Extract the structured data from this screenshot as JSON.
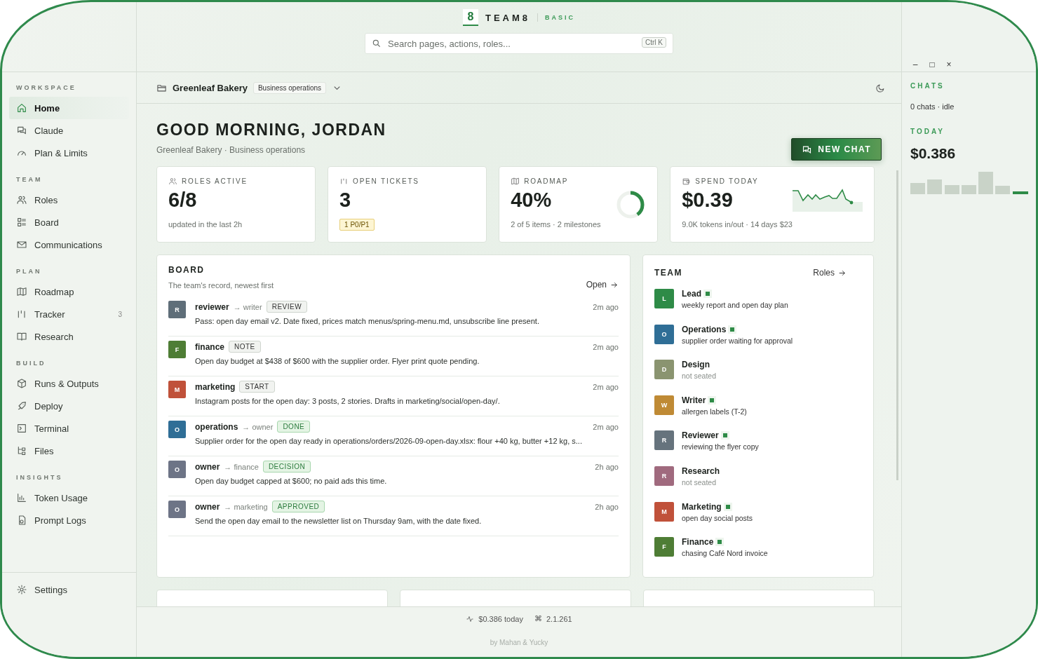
{
  "brand": {
    "logo": "8",
    "name": "TEAM8",
    "plan": "BASIC"
  },
  "search": {
    "placeholder": "Search pages, actions, roles...",
    "shortcut": "Ctrl K"
  },
  "window_controls": [
    "–",
    "□",
    "×"
  ],
  "sidebar": {
    "sections": [
      {
        "label": "WORKSPACE",
        "items": [
          {
            "label": "Home",
            "selected": true
          },
          {
            "label": "Claude",
            "selected": false
          },
          {
            "label": "Plan & Limits",
            "selected": false
          }
        ]
      },
      {
        "label": "TEAM",
        "items": [
          {
            "label": "Roles",
            "selected": false
          },
          {
            "label": "Board",
            "selected": false
          },
          {
            "label": "Communications",
            "selected": false
          }
        ]
      },
      {
        "label": "PLAN",
        "items": [
          {
            "label": "Roadmap",
            "selected": false
          },
          {
            "label": "Tracker",
            "selected": false,
            "count": "3"
          },
          {
            "label": "Research",
            "selected": false
          }
        ]
      },
      {
        "label": "BUILD",
        "items": [
          {
            "label": "Runs & Outputs",
            "selected": false
          },
          {
            "label": "Deploy",
            "selected": false
          },
          {
            "label": "Terminal",
            "selected": false
          },
          {
            "label": "Files",
            "selected": false
          }
        ]
      },
      {
        "label": "INSIGHTS",
        "items": [
          {
            "label": "Token Usage",
            "selected": false
          },
          {
            "label": "Prompt Logs",
            "selected": false
          }
        ]
      }
    ],
    "footer_item": {
      "label": "Settings",
      "selected": false
    }
  },
  "breadcrumb": {
    "workspace": "Greenleaf Bakery",
    "tag": "Business operations"
  },
  "greeting": {
    "title": "GOOD MORNING, JORDAN",
    "subtitle": "Greenleaf Bakery · Business operations"
  },
  "new_chat_button": "NEW CHAT",
  "stats": [
    {
      "kind": "plain",
      "label": "ROLES ACTIVE",
      "value": "6/8",
      "note": "updated in the last 2h"
    },
    {
      "kind": "badge",
      "label": "OPEN TICKETS",
      "value": "3",
      "badge": "1 P0/P1"
    },
    {
      "kind": "ring",
      "label": "ROADMAP",
      "value": "40%",
      "level": 0.4,
      "note": "2 of 5 items · 2 milestones"
    },
    {
      "kind": "sparkline",
      "label": "SPEND TODAY",
      "value": "$0.39",
      "note": "9.0K tokens in/out · 14 days $23"
    }
  ],
  "board": {
    "title": "BOARD",
    "subtitle": "The team's record, newest first",
    "link": "Open",
    "entries": [
      {
        "initial": "R",
        "color": "#5f6e79",
        "from": "reviewer",
        "to": "→ writer",
        "tag": "REVIEW",
        "kind": "neutral",
        "time": "2m ago",
        "text": "Pass: open day email v2. Date fixed, prices match menus/spring-menu.md, unsubscribe line present."
      },
      {
        "initial": "F",
        "color": "#4e7d35",
        "from": "finance",
        "tag": "NOTE",
        "kind": "neutral",
        "time": "2m ago",
        "text": "Open day budget at $438 of $600 with the supplier order. Flyer print quote pending."
      },
      {
        "initial": "M",
        "color": "#c0513a",
        "from": "marketing",
        "tag": "START",
        "kind": "neutral",
        "time": "2m ago",
        "text": "Instagram posts for the open day: 3 posts, 2 stories. Drafts in marketing/social/open-day/."
      },
      {
        "initial": "O",
        "color": "#2f6e96",
        "from": "operations",
        "to": "→ owner",
        "tag": "DONE",
        "kind": "positive",
        "time": "2m ago",
        "text": "Supplier order for the open day ready in operations/orders/2026-09-open-day.xlsx: flour +40 kg, butter +12 kg, s..."
      },
      {
        "initial": "O",
        "color": "#6d7486",
        "from": "owner",
        "to": "→ finance",
        "tag": "DECISION",
        "kind": "positive",
        "time": "2h ago",
        "text": "Open day budget capped at $600; no paid ads this time."
      },
      {
        "initial": "O",
        "color": "#6d7486",
        "from": "owner",
        "to": "→ marketing",
        "tag": "APPROVED",
        "kind": "positive",
        "time": "2h ago",
        "text": "Send the open day email to the newsletter list on Thursday 9am, with the date fixed."
      }
    ]
  },
  "team": {
    "title": "TEAM",
    "link": "Roles",
    "members": [
      {
        "initial": "L",
        "color": "#2e8b47",
        "name": "Lead",
        "online": true,
        "note": "weekly report and open day plan"
      },
      {
        "initial": "O",
        "color": "#2f6e96",
        "name": "Operations",
        "online": true,
        "note": "supplier order waiting for approval"
      },
      {
        "initial": "D",
        "color": "#8a9470",
        "name": "Design",
        "online": false,
        "note": "not seated"
      },
      {
        "initial": "W",
        "color": "#bf8a35",
        "name": "Writer",
        "online": true,
        "note": "allergen labels (T-2)"
      },
      {
        "initial": "R",
        "color": "#66737d",
        "name": "Reviewer",
        "online": true,
        "note": "reviewing the flyer copy"
      },
      {
        "initial": "R",
        "color": "#a06a7e",
        "name": "Research",
        "online": false,
        "note": "not seated"
      },
      {
        "initial": "M",
        "color": "#c0513a",
        "name": "Marketing",
        "online": true,
        "note": "open day social posts"
      },
      {
        "initial": "F",
        "color": "#4e7d35",
        "name": "Finance",
        "online": true,
        "note": "chasing Café Nord invoice"
      }
    ]
  },
  "status_bar": {
    "spend": "$0.386 today",
    "version_glyph": "⌘",
    "version": "2.1.261",
    "credit": "by Mahan & Yucky"
  },
  "right_panel": {
    "chats_title": "CHATS",
    "chats_status": "0 chats · idle",
    "today_title": "TODAY",
    "today_value": "$0.386"
  }
}
